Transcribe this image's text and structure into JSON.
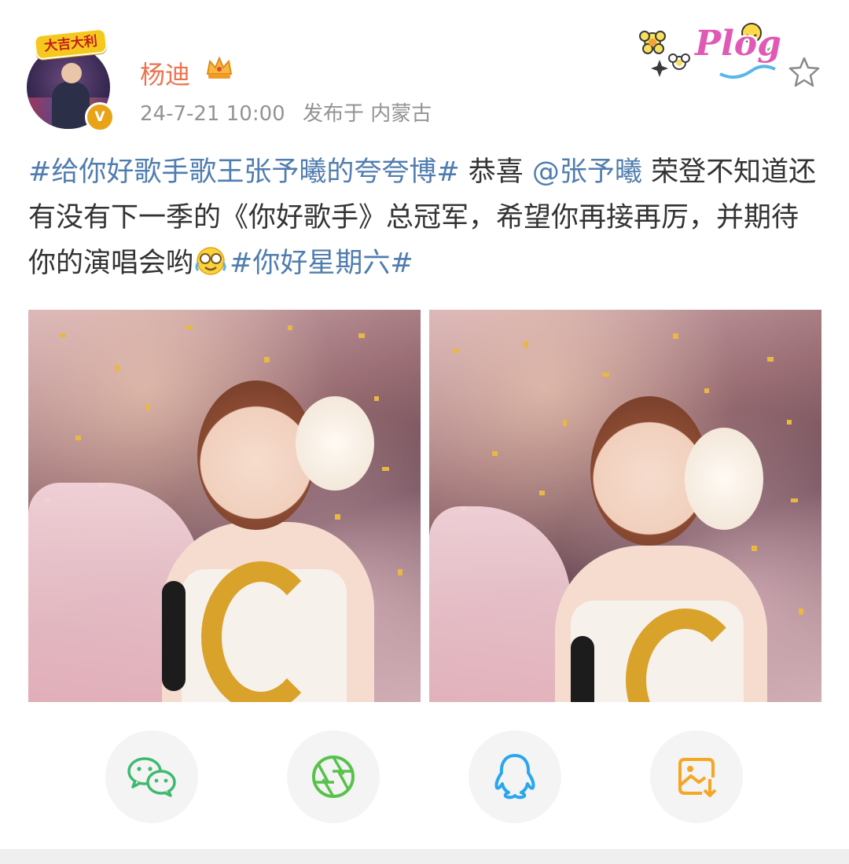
{
  "post": {
    "author": "杨迪",
    "avatar_sticker": "大吉大利",
    "verified_mark": "V",
    "date": "24-7-21 10:00",
    "location": "发布于 内蒙古",
    "sticker": "Plog",
    "text": {
      "topic1": "#给你好歌手歌王张予曦的夸夸博#",
      "part1": " 恭喜 ",
      "mention": "@张予曦",
      "part2": " 荣登不知道还有没有下一季的《你好歌手》总冠军，希望你再接再厉，并期待你的演唱会哟",
      "topic2": "#你好星期六#"
    },
    "images": [
      {
        "icon": "photo-winner-left"
      },
      {
        "icon": "photo-winner-right"
      }
    ]
  },
  "share_actions": [
    {
      "icon": "wechat-icon",
      "color": "#3dba6e"
    },
    {
      "icon": "moments-icon",
      "color": "#57c24a"
    },
    {
      "icon": "qq-icon",
      "color": "#2aa6ee"
    },
    {
      "icon": "save-image-icon",
      "color": "#f5a623"
    }
  ],
  "colors": {
    "username": "#eb7350",
    "link": "#507daf",
    "meta": "#939393",
    "body_text": "#333333"
  }
}
